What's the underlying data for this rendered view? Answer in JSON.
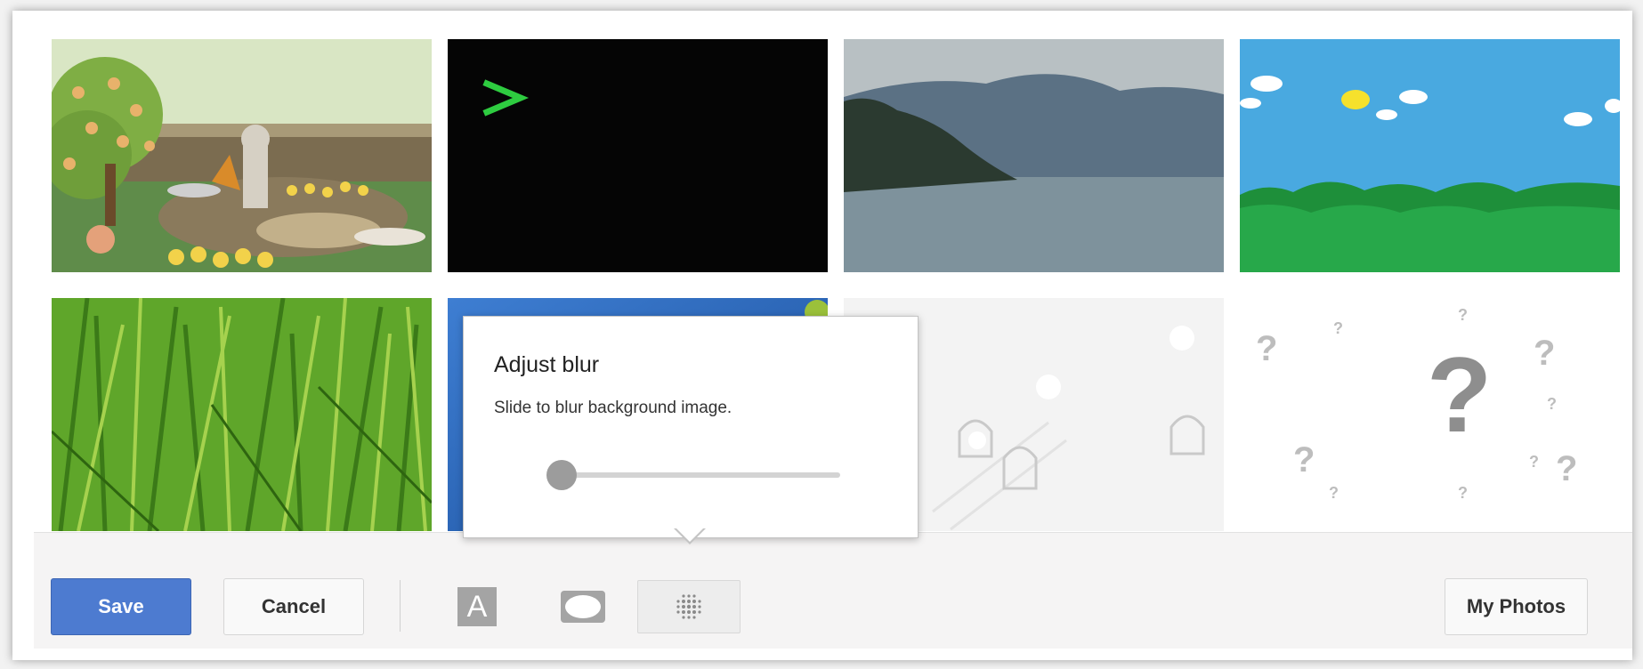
{
  "backgrounds": [
    {
      "name": "garden"
    },
    {
      "name": "terminal",
      "glyph": ">"
    },
    {
      "name": "lake"
    },
    {
      "name": "pixel-sky"
    },
    {
      "name": "grass"
    },
    {
      "name": "blue-gradient"
    },
    {
      "name": "android-doodle"
    },
    {
      "name": "question-marks",
      "glyph": "?"
    }
  ],
  "blur_popup": {
    "title": "Adjust blur",
    "description": "Slide to blur background image.",
    "slider_value": 0
  },
  "toolbar": {
    "save_label": "Save",
    "cancel_label": "Cancel",
    "text_tool_glyph": "A",
    "shape_tool_icon": "rounded-rect-icon",
    "blur_tool_icon": "blur-dots-icon",
    "my_photos_label": "My Photos"
  },
  "colors": {
    "accent": "#4d7bd0",
    "terminal_prompt": "#2ecc40"
  }
}
